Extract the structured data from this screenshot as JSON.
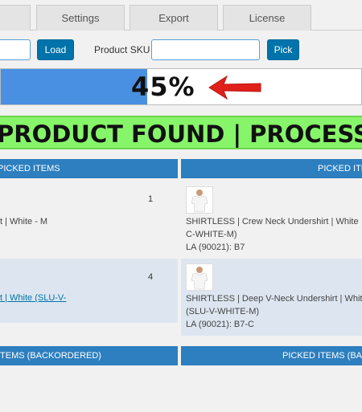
{
  "tabs": [
    {
      "label": ""
    },
    {
      "label": "Settings"
    },
    {
      "label": "Export"
    },
    {
      "label": "License"
    }
  ],
  "toolbar": {
    "load_label": "Load",
    "sku_label": "Product SKU",
    "pick_label": "Pick"
  },
  "progress": {
    "percent_value": 45,
    "percent_text": "45%"
  },
  "banner": {
    "text": "PRODUCT FOUND | PROCESSING"
  },
  "columns": {
    "to_pick": "PICKED ITEMS",
    "picked": "PICKED ITEMS",
    "to_pick_backordered": "ITEMS (BACKORDERED)",
    "picked_backordered": "PICKED ITEMS (BACKORDERED)"
  },
  "left_items": [
    {
      "qty": "1",
      "name": "t | White - M"
    },
    {
      "qty": "4",
      "name": "t | White (SLU-V-"
    }
  ],
  "right_items": [
    {
      "name": "SHIRTLESS | Crew Neck Undershirt | White",
      "sku": "C-WHITE-M)",
      "location": "LA (90021): B7"
    },
    {
      "name": "SHIRTLESS | Deep V-Neck Undershirt | White",
      "sku": "(SLU-V-WHITE-M)",
      "location": "LA (90021): B7-C"
    }
  ],
  "colors": {
    "accent": "#2d7fbf",
    "progress": "#4a90e2",
    "banner": "#87f56a",
    "arrow": "#e0201a"
  }
}
